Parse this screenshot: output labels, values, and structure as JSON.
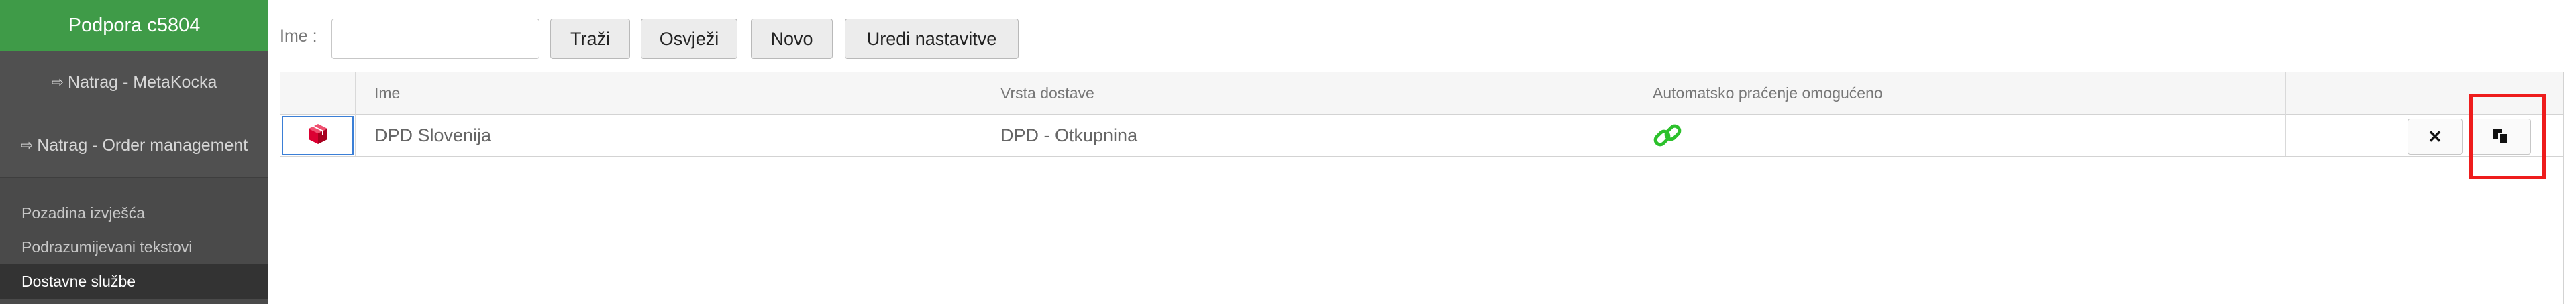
{
  "sidebar": {
    "header": "Podpora c5804",
    "nav": [
      {
        "icon": "sign-out-icon",
        "label": "Natrag - MetaKocka"
      },
      {
        "icon": "sign-out-icon",
        "label": "Natrag - Order management"
      }
    ],
    "items": [
      {
        "label": "Pozadina izvješća"
      },
      {
        "label": "Podrazumijevani tekstovi"
      },
      {
        "label": "Dostavne službe",
        "active": true
      }
    ]
  },
  "toolbar": {
    "name_label": "Ime :",
    "name_value": "",
    "name_placeholder": "",
    "search_label": "Traži",
    "refresh_label": "Osvježi",
    "new_label": "Novo",
    "edit_settings_label": "Uredi nastavitve"
  },
  "grid": {
    "columns": [
      "",
      "Ime",
      "Vrsta dostave",
      "Automatsko praćenje omogućeno",
      ""
    ],
    "rows": [
      {
        "icon": "dpd-cube-icon",
        "name": "DPD Slovenija",
        "delivery_type": "DPD - Otkupnina",
        "tracking_enabled": true,
        "tracking_icon": "link-icon",
        "delete_label": "✕"
      }
    ]
  },
  "colors": {
    "sidebar_bg": "#4a4a4a",
    "sidebar_header": "#3f9b48",
    "active_item": "#333333",
    "link_icon": "#2cc12c",
    "dpd_red": "#dc0032",
    "highlight": "#ee1c1c"
  }
}
